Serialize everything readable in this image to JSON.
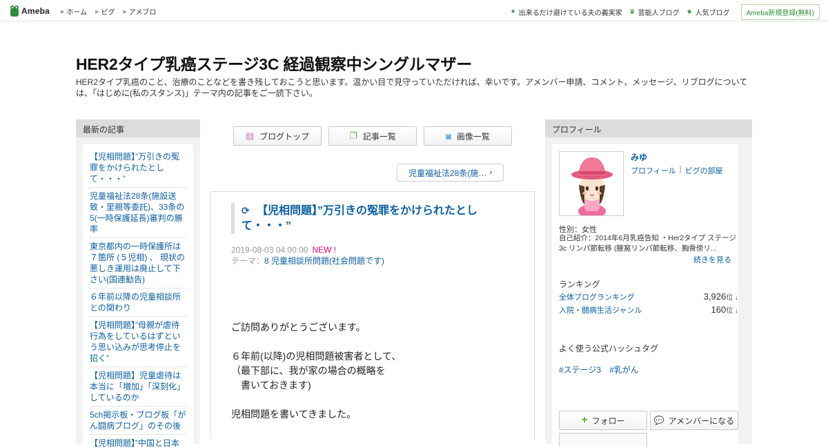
{
  "header": {
    "logo": "Ameba",
    "nav": [
      "ホーム",
      "ピグ",
      "アメブロ"
    ],
    "right_links": [
      {
        "icon": "sparkle-icon",
        "label": "出来るだけ避けている夫の義実家"
      },
      {
        "icon": "crown-icon",
        "label": "芸能人ブログ"
      },
      {
        "icon": "star-icon",
        "label": "人気ブログ"
      }
    ],
    "register": "Ameba新規登録(無料)"
  },
  "blog": {
    "title": "HER2タイプ乳癌ステージ3C 経過観察中シングルマザー",
    "description": "HER2タイプ乳癌のこと、治療のことなどを書き残しておこうと思います。温かい目で見守っていただければ、幸いです。アメンバー申請、コメント、メッセージ、リブログについては、「はじめに(私のスタンス)」テーマ内の記事をご一読下さい。"
  },
  "left": {
    "heading": "最新の記事",
    "entries": [
      "【児相問題】”万引きの冤罪をかけられたとして・・・”",
      "児童福祉法28条(施設送致・里親等委託)、33条の5(一時保護延長)審判の勝率",
      "東京都内の一時保護所は７箇所 (５児相) 、 現状の悪しき運用は廃止して下さい(国連勧告)",
      "６年前以降の児童相談所との関わり",
      "【児相問題】”母親が虐待行為をしているはずという思い込みが思考停止を招く”",
      "【児相問題】児童虐待は本当に「増加」「深刻化」しているのか",
      "5ch掲示板・ブログ板「がん闘病ブログ」のその後",
      "【児相問題】”中国と日本"
    ]
  },
  "tabs": [
    {
      "icon": "document-icon",
      "label": "ブログトップ"
    },
    {
      "icon": "copy-icon",
      "label": "記事一覧"
    },
    {
      "icon": "camera-icon",
      "label": "画像一覧"
    }
  ],
  "next_link": "児童福祉法28条(施…",
  "article": {
    "title": "【児相問題】”万引きの冤罪をかけられたとして・・・”",
    "date": "2019-08-03 04:00:00",
    "new_badge": "NEW !",
    "theme_label": "テーマ：",
    "theme": "8 児童相談所問題(社会問題です)",
    "body": [
      "ご訪問ありがとうございます。",
      "６年前(以降)の児相問題被害者として、\n（最下部に、我が家の場合の概略を\n　書いておきます)",
      "児相問題を書いてきました。"
    ]
  },
  "profile": {
    "heading": "プロフィール",
    "name": "みゆ",
    "link_profile": "プロフィール",
    "link_pigg": "ピグの部屋",
    "gender": "性別：女性",
    "intro": "自己紹介：2014年6月乳癌告知 ・Her2タイプ ステージ3c リンパ節転移 (腋窩リンパ節転移、胸骨傍リ...",
    "more": "続きを見る",
    "ranking_heading": "ランキング",
    "rankings": [
      {
        "label": "全体ブログランキング",
        "value": "3,926",
        "unit": "位 ↓"
      },
      {
        "label": "入院・闘病生活ジャンル",
        "value": "160",
        "unit": "位 ↓"
      }
    ],
    "hashtag_heading": "よく使う公式ハッシュタグ",
    "hashtags": [
      "#ステージ3",
      "#乳がん"
    ],
    "follow": "フォロー",
    "amember": "アメンバーになる"
  }
}
